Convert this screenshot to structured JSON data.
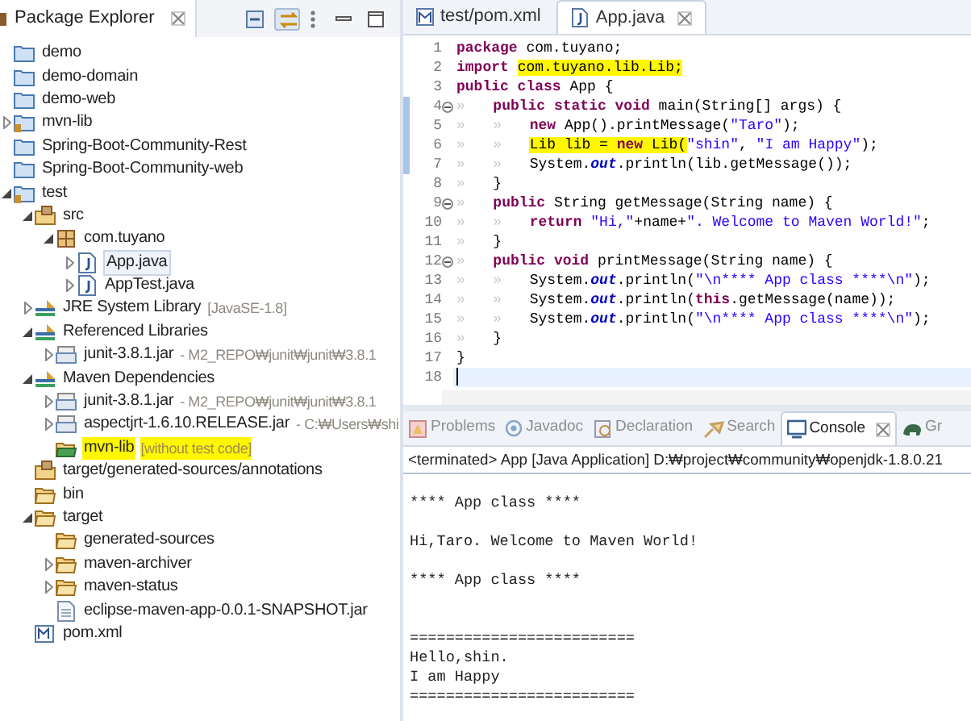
{
  "package_explorer": {
    "title": "Package Explorer",
    "tree": [
      {
        "label": "demo",
        "kind": "project",
        "selected": false
      },
      {
        "label": "demo-domain",
        "kind": "project",
        "selected": false
      },
      {
        "label": "demo-web",
        "kind": "project",
        "selected": false
      },
      {
        "label": "mvn-lib",
        "kind": "maven-project",
        "expanded": false,
        "selected": false
      },
      {
        "label": "Spring-Boot-Community-Rest",
        "kind": "project",
        "selected": false
      },
      {
        "label": "Spring-Boot-Community-web",
        "kind": "project",
        "selected": false
      },
      {
        "label": "test",
        "kind": "maven-project",
        "expanded": true,
        "selected": false,
        "children": [
          {
            "label": "src",
            "kind": "source-folder",
            "expanded": true,
            "selected": false,
            "children": [
              {
                "label": "com.tuyano",
                "kind": "package",
                "expanded": true,
                "selected": false,
                "children": [
                  {
                    "label": "App.java",
                    "kind": "java-file",
                    "expanded": false,
                    "selected": true
                  },
                  {
                    "label": "AppTest.java",
                    "kind": "java-file",
                    "expanded": false,
                    "selected": false
                  }
                ]
              }
            ]
          },
          {
            "label": "JRE System Library",
            "decoration": "[JavaSE-1.8]",
            "kind": "library",
            "expanded": false,
            "selected": false
          },
          {
            "label": "Referenced Libraries",
            "kind": "library",
            "expanded": true,
            "selected": false,
            "children": [
              {
                "label": "junit-3.8.1.jar",
                "decoration": "- M2_REPO₩junit₩junit₩3.8.1",
                "kind": "jar",
                "expanded": false,
                "selected": false
              }
            ]
          },
          {
            "label": "Maven Dependencies",
            "kind": "library",
            "expanded": true,
            "selected": false,
            "children": [
              {
                "label": "junit-3.8.1.jar",
                "decoration": "- M2_REPO₩junit₩junit₩3.8.1",
                "kind": "jar",
                "expanded": false,
                "selected": false
              },
              {
                "label": "aspectjrt-1.6.10.RELEASE.jar",
                "decoration": "- C:₩Users₩shi",
                "kind": "jar",
                "expanded": false,
                "selected": false
              },
              {
                "label": "mvn-lib",
                "decoration": "[without test code]",
                "kind": "project-folder",
                "selected": false,
                "highlighted": true
              }
            ]
          },
          {
            "label": "target/generated-sources/annotations",
            "kind": "source-folder",
            "selected": false
          },
          {
            "label": "bin",
            "kind": "folder",
            "selected": false
          },
          {
            "label": "target",
            "kind": "folder",
            "expanded": true,
            "selected": false,
            "children": [
              {
                "label": "generated-sources",
                "kind": "folder",
                "selected": false
              },
              {
                "label": "maven-archiver",
                "kind": "folder",
                "expanded": false,
                "selected": false
              },
              {
                "label": "maven-status",
                "kind": "folder",
                "expanded": false,
                "selected": false
              },
              {
                "label": "eclipse-maven-app-0.0.1-SNAPSHOT.jar",
                "kind": "file",
                "selected": false
              }
            ]
          },
          {
            "label": "pom.xml",
            "kind": "xml-file",
            "selected": false
          }
        ]
      }
    ]
  },
  "editor": {
    "tabs": [
      {
        "label": "test/pom.xml",
        "kind": "xml",
        "selected": false
      },
      {
        "label": "App.java",
        "kind": "java",
        "selected": true
      }
    ],
    "lines": [
      {
        "number": "1",
        "segments": [
          {
            "kind": "keyword",
            "text": "package"
          },
          {
            "kind": "plain",
            "text": " com.tuyano;"
          }
        ]
      },
      {
        "number": "2",
        "segments": [
          {
            "kind": "keyword",
            "text": "import "
          },
          {
            "kind": "plain",
            "text": "com.tuyano.lib.Lib;",
            "highlighted": true
          }
        ]
      },
      {
        "number": "3",
        "segments": [
          {
            "kind": "keyword",
            "text": "public class"
          },
          {
            "kind": "plain",
            "text": " App {"
          }
        ]
      },
      {
        "number": "4",
        "fold": true,
        "changed": true,
        "tabs": [
          "»"
        ],
        "segments": [
          {
            "kind": "keyword",
            "text": "public static void"
          },
          {
            "kind": "plain",
            "text": " main(String[] args) {"
          }
        ]
      },
      {
        "number": "5",
        "changed": true,
        "tabs": [
          "»",
          "»"
        ],
        "segments": [
          {
            "kind": "keyword",
            "text": "new"
          },
          {
            "kind": "plain",
            "text": " App().printMessage("
          },
          {
            "kind": "string",
            "text": "\"Taro\""
          },
          {
            "kind": "plain",
            "text": ");"
          }
        ]
      },
      {
        "number": "6",
        "changed": true,
        "tabs": [
          "»",
          "»"
        ],
        "segments": [
          {
            "kind": "plain",
            "text": "Lib lib = ",
            "highlighted": true
          },
          {
            "kind": "keyword",
            "text": "new",
            "highlighted": true
          },
          {
            "kind": "plain",
            "text": " Lib(",
            "highlighted": true
          },
          {
            "kind": "string",
            "text": "\"shin\""
          },
          {
            "kind": "plain",
            "text": ", "
          },
          {
            "kind": "string",
            "text": "\"I am Happy\""
          },
          {
            "kind": "plain",
            "text": ");"
          }
        ]
      },
      {
        "number": "7",
        "changed": true,
        "tabs": [
          "»",
          "»"
        ],
        "segments": [
          {
            "kind": "plain",
            "text": "System."
          },
          {
            "kind": "field",
            "text": "out"
          },
          {
            "kind": "plain",
            "text": ".println(lib.getMessage());"
          }
        ]
      },
      {
        "number": "8",
        "tabs": [
          "»"
        ],
        "segments": [
          {
            "kind": "plain",
            "text": "}"
          }
        ]
      },
      {
        "number": "9",
        "fold": true,
        "tabs": [
          "»"
        ],
        "segments": [
          {
            "kind": "keyword",
            "text": "public"
          },
          {
            "kind": "plain",
            "text": " String getMessage(String name) {"
          }
        ]
      },
      {
        "number": "10",
        "tabs": [
          "»",
          "»"
        ],
        "segments": [
          {
            "kind": "keyword",
            "text": "return "
          },
          {
            "kind": "string",
            "text": "\"Hi,\""
          },
          {
            "kind": "plain",
            "text": "+name+"
          },
          {
            "kind": "string",
            "text": "\". Welcome to Maven World!\""
          },
          {
            "kind": "plain",
            "text": ";"
          }
        ]
      },
      {
        "number": "11",
        "tabs": [
          "»"
        ],
        "segments": [
          {
            "kind": "plain",
            "text": "}"
          }
        ]
      },
      {
        "number": "12",
        "fold": true,
        "tabs": [
          "»"
        ],
        "segments": [
          {
            "kind": "keyword",
            "text": "public void"
          },
          {
            "kind": "plain",
            "text": " printMessage(String name) {"
          }
        ]
      },
      {
        "number": "13",
        "tabs": [
          "»",
          "»"
        ],
        "segments": [
          {
            "kind": "plain",
            "text": "System."
          },
          {
            "kind": "field",
            "text": "out"
          },
          {
            "kind": "plain",
            "text": ".println("
          },
          {
            "kind": "string",
            "text": "\"\\n**** App class ****\\n\""
          },
          {
            "kind": "plain",
            "text": ");"
          }
        ]
      },
      {
        "number": "14",
        "tabs": [
          "»",
          "»"
        ],
        "segments": [
          {
            "kind": "plain",
            "text": "System."
          },
          {
            "kind": "field",
            "text": "out"
          },
          {
            "kind": "plain",
            "text": ".println("
          },
          {
            "kind": "keyword",
            "text": "this"
          },
          {
            "kind": "plain",
            "text": ".getMessage(name));"
          }
        ]
      },
      {
        "number": "15",
        "tabs": [
          "»",
          "»"
        ],
        "segments": [
          {
            "kind": "plain",
            "text": "System."
          },
          {
            "kind": "field",
            "text": "out"
          },
          {
            "kind": "plain",
            "text": ".println("
          },
          {
            "kind": "string",
            "text": "\"\\n**** App class ****\\n\""
          },
          {
            "kind": "plain",
            "text": ");"
          }
        ]
      },
      {
        "number": "16",
        "tabs": [
          "»"
        ],
        "segments": [
          {
            "kind": "plain",
            "text": "}"
          }
        ]
      },
      {
        "number": "17",
        "segments": [
          {
            "kind": "plain",
            "text": "}"
          }
        ]
      },
      {
        "number": "18",
        "cursor": true
      }
    ]
  },
  "bottom_panel": {
    "tabs": [
      {
        "label": "Problems",
        "kind": "problems",
        "selected": false
      },
      {
        "label": "Javadoc",
        "kind": "javadoc",
        "selected": false
      },
      {
        "label": "Declaration",
        "kind": "declaration",
        "selected": false
      },
      {
        "label": "Search",
        "kind": "search",
        "selected": false
      },
      {
        "label": "Console",
        "kind": "console",
        "selected": true
      },
      {
        "label": "Gr",
        "kind": "gradle",
        "selected": false
      }
    ],
    "console": {
      "header": "<terminated> App [Java Application] D:₩project₩community₩openjdk-1.8.0.21",
      "blocks": [
        {
          "lines": [
            "**** App class ****"
          ]
        },
        {
          "lines": [
            "Hi,Taro. Welcome to Maven World!"
          ]
        },
        {
          "lines": [
            "**** App class ****"
          ]
        },
        {
          "lines": [
            "=========================",
            "Hello,shin.",
            "I am Happy",
            "========================="
          ]
        }
      ]
    }
  }
}
